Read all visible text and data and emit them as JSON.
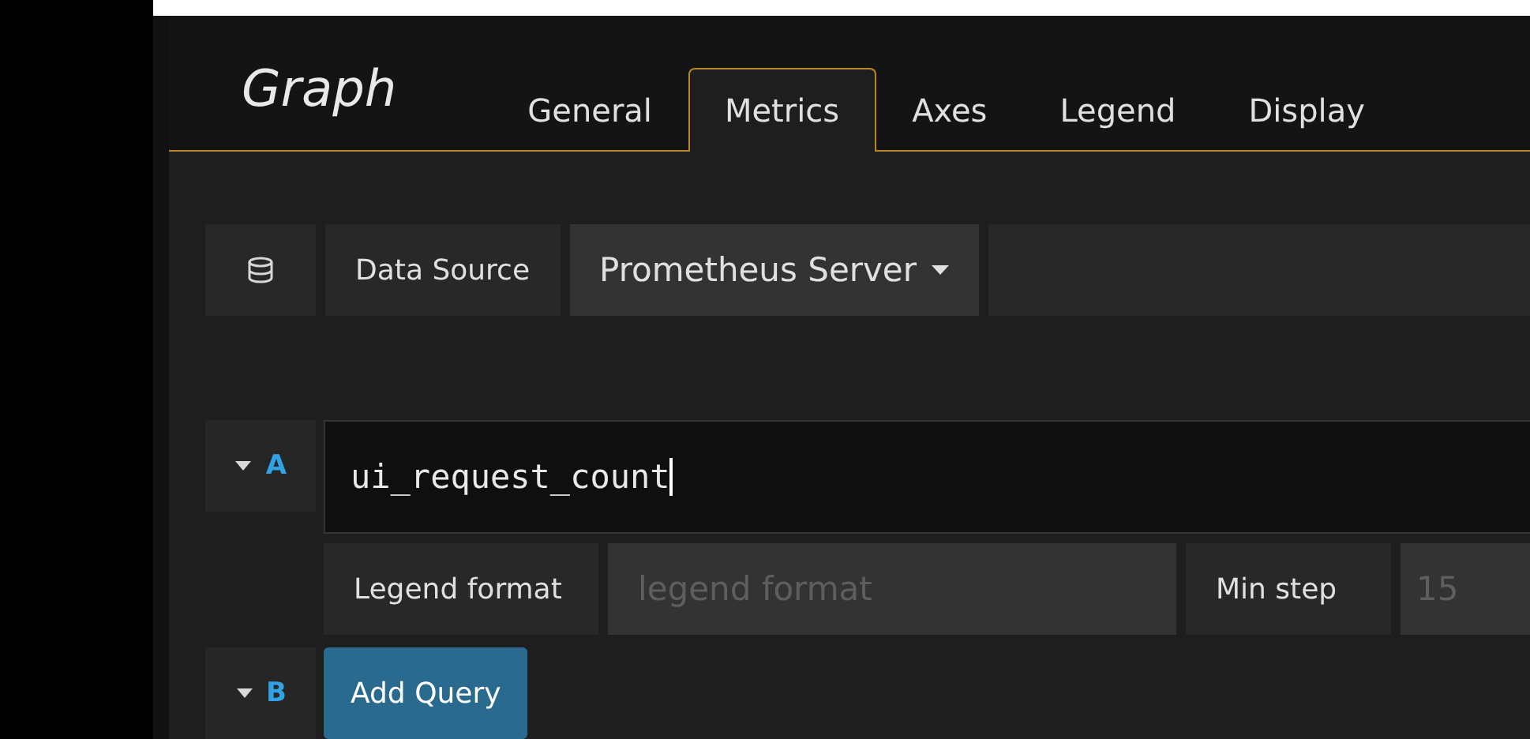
{
  "panel": {
    "title": "Graph"
  },
  "tabs": [
    {
      "label": "General",
      "selected": false
    },
    {
      "label": "Metrics",
      "selected": true
    },
    {
      "label": "Axes",
      "selected": false
    },
    {
      "label": "Legend",
      "selected": false
    },
    {
      "label": "Display",
      "selected": false
    }
  ],
  "data_source": {
    "label": "Data Source",
    "value": "Prometheus Server"
  },
  "queries": [
    {
      "kind": "query",
      "ref_id": "A",
      "expanded": true,
      "value": "ui_request_count",
      "legend_label": "Legend format",
      "legend_placeholder": "legend format",
      "min_step_label": "Min step",
      "min_step_placeholder": "15"
    },
    {
      "kind": "add",
      "ref_id": "B",
      "expanded": true,
      "button": "Add Query"
    }
  ]
}
